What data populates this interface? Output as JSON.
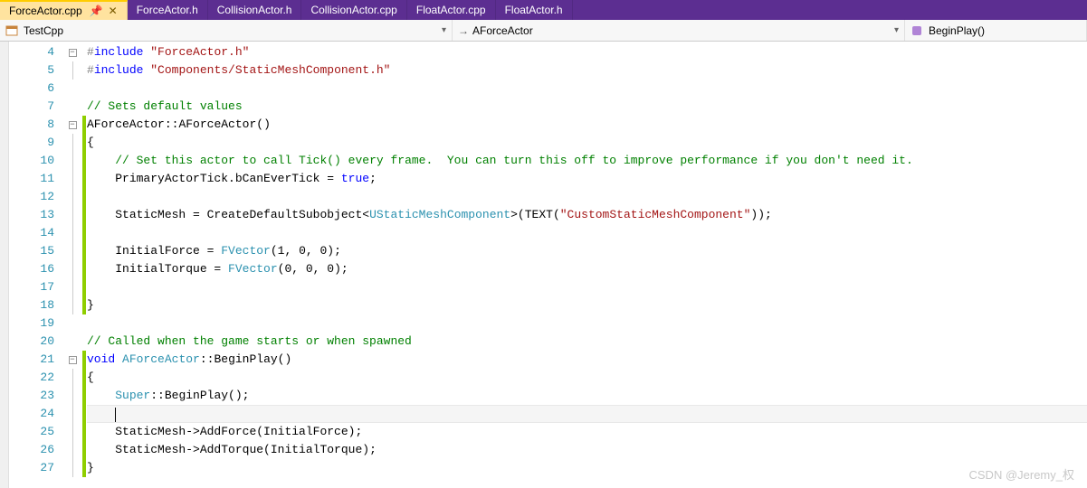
{
  "tabs": [
    {
      "label": "ForceActor.cpp",
      "active": true
    },
    {
      "label": "ForceActor.h",
      "active": false
    },
    {
      "label": "CollisionActor.h",
      "active": false
    },
    {
      "label": "CollisionActor.cpp",
      "active": false
    },
    {
      "label": "FloatActor.cpp",
      "active": false
    },
    {
      "label": "FloatActor.h",
      "active": false
    }
  ],
  "nav": {
    "scope": "TestCpp",
    "class": "AForceActor",
    "arrow": "→",
    "method": "BeginPlay()"
  },
  "lines": {
    "start": 4,
    "end": 27
  },
  "code": {
    "l4": {
      "pp": "#",
      "inc": "include ",
      "str": "\"ForceActor.h\""
    },
    "l5": {
      "pp": "#",
      "inc": "include ",
      "str": "\"Components/StaticMeshComponent.h\""
    },
    "l7": {
      "comment": "// Sets default values"
    },
    "l8": {
      "a": "AForceActor",
      "sep": "::",
      "b": "AForceActor",
      "paren": "()"
    },
    "l9": {
      "brace": "{"
    },
    "l10": {
      "comment": "// Set this actor to call Tick() every frame.  You can turn this off to improve performance if you don't need it."
    },
    "l11": {
      "a": "PrimaryActorTick.bCanEverTick = ",
      "kw": "true",
      "end": ";"
    },
    "l13": {
      "a": "StaticMesh = CreateDefaultSubobject<",
      "t": "UStaticMeshComponent",
      "b": ">(",
      "fn": "TEXT",
      "p": "(",
      "s": "\"CustomStaticMeshComponent\"",
      "e": "));"
    },
    "l15": {
      "a": "InitialForce = ",
      "t": "FVector",
      "b": "(1, 0, 0);"
    },
    "l16": {
      "a": "InitialTorque = ",
      "t": "FVector",
      "b": "(0, 0, 0);"
    },
    "l18": {
      "brace": "}"
    },
    "l20": {
      "comment": "// Called when the game starts or when spawned"
    },
    "l21": {
      "kw": "void",
      "sp": " ",
      "t": "AForceActor",
      "sep": "::",
      "m": "BeginPlay()"
    },
    "l22": {
      "brace": "{"
    },
    "l23": {
      "t": "Super",
      "rest": "::BeginPlay();"
    },
    "l25": {
      "text": "StaticMesh->AddForce(InitialForce);"
    },
    "l26": {
      "text": "StaticMesh->AddTorque(InitialTorque);"
    },
    "l27": {
      "brace": "}"
    }
  },
  "foldbox": "−",
  "watermark": "CSDN @Jeremy_权"
}
